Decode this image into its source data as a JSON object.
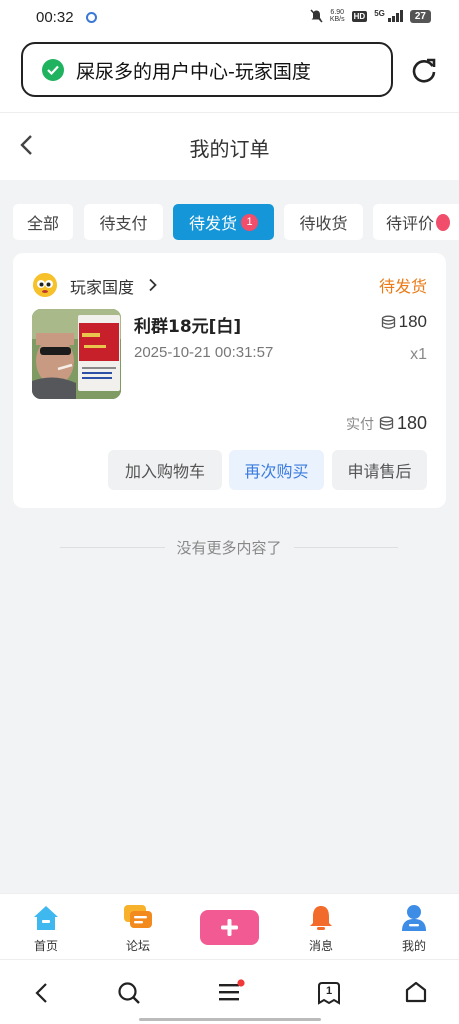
{
  "status_bar": {
    "time": "00:32",
    "net_speed_value": "6.90",
    "net_speed_unit": "KB/s",
    "hd_label": "HD",
    "signal_label": "5G",
    "battery": "27"
  },
  "browser": {
    "url_title": "屎尿多的用户中心-玩家国度"
  },
  "header": {
    "title": "我的订单"
  },
  "tabs": [
    {
      "label": "全部"
    },
    {
      "label": "待支付"
    },
    {
      "label": "待发货",
      "badge": "1",
      "active": true
    },
    {
      "label": "待收货"
    },
    {
      "label": "待评价"
    }
  ],
  "order": {
    "shop_name": "玩家国度",
    "status": "待发货",
    "product_name": "利群18元[白]",
    "date": "2025-10-21 00:31:57",
    "price": "180",
    "quantity": "x1",
    "paid_label": "实付",
    "paid_amount": "180",
    "buttons": {
      "add_to_cart": "加入购物车",
      "buy_again": "再次购买",
      "after_sales": "申请售后"
    }
  },
  "list_end_text": "没有更多内容了",
  "bottom_nav": {
    "home": "首页",
    "forum": "论坛",
    "messages": "消息",
    "mine": "我的"
  },
  "system_nav": {
    "tabs_count": "1"
  },
  "colors": {
    "accent": "#1496d8",
    "badge": "#f04e6a",
    "status_orange": "#ea7b18",
    "plus_button": "#f25a93",
    "link_blue": "#3b7ce0"
  }
}
